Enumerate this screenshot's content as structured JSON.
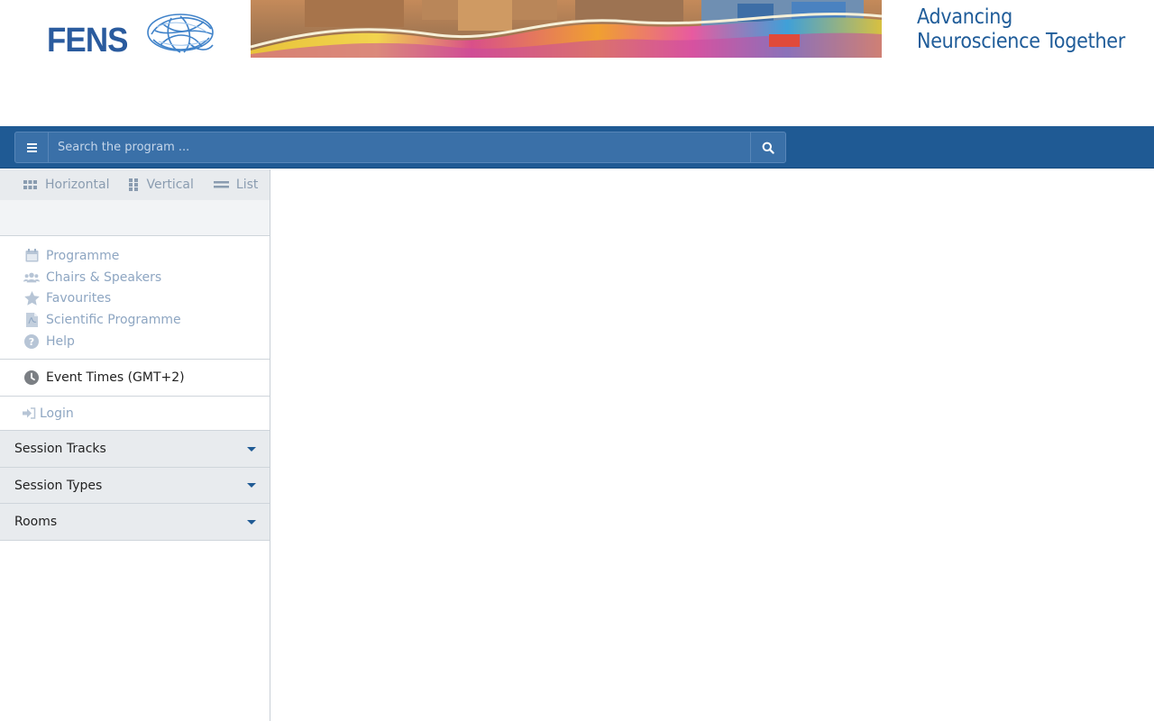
{
  "header": {
    "logo_text": "FENS",
    "tagline_line1": "Advancing",
    "tagline_line2": "Neuroscience Together"
  },
  "search": {
    "placeholder": "Search the program ..."
  },
  "views": [
    {
      "label": "Horizontal",
      "icon": "grid-horizontal-icon"
    },
    {
      "label": "Vertical",
      "icon": "grid-vertical-icon"
    },
    {
      "label": "List",
      "icon": "list-icon"
    }
  ],
  "nav": [
    {
      "label": "Programme",
      "icon": "calendar-icon"
    },
    {
      "label": "Chairs & Speakers",
      "icon": "users-icon"
    },
    {
      "label": "Favourites",
      "icon": "star-icon"
    },
    {
      "label": "Scientific Programme",
      "icon": "pdf-file-icon"
    },
    {
      "label": "Help",
      "icon": "question-circle-icon"
    }
  ],
  "event_times": {
    "label": "Event Times (GMT+2)",
    "icon": "clock-icon"
  },
  "login": {
    "label": "Login",
    "icon": "sign-in-icon"
  },
  "filters": [
    {
      "label": "Session Tracks"
    },
    {
      "label": "Session Types"
    },
    {
      "label": "Rooms"
    }
  ],
  "colors": {
    "brand_blue": "#1f5a94",
    "link_muted": "#8ea6c2",
    "panel_gray": "#e8ebee"
  }
}
